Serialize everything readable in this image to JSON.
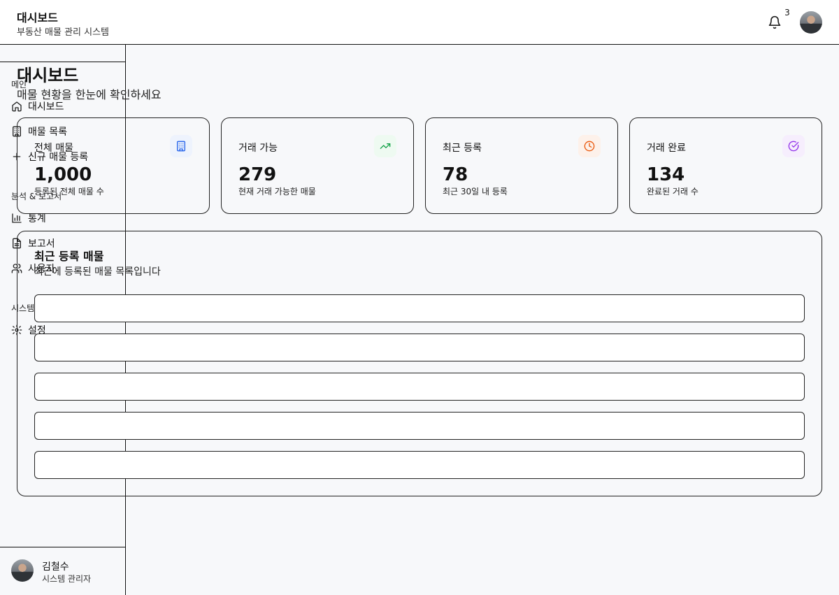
{
  "header": {
    "title": "대시보드",
    "subtitle": "부동산 매물 관리 시스템",
    "notification_count": "3"
  },
  "sidebar": {
    "sections": [
      {
        "label": "메인"
      },
      {
        "label": "분석 & 보고서"
      },
      {
        "label": "시스템"
      }
    ],
    "items": [
      {
        "label": "대시보드",
        "icon": "home-icon"
      },
      {
        "label": "매물 목록",
        "icon": "building-icon"
      },
      {
        "label": "신규 매물 등록",
        "icon": "plus-icon"
      },
      {
        "label": "통계",
        "icon": "bar-chart-icon"
      },
      {
        "label": "보고서",
        "icon": "file-text-icon"
      },
      {
        "label": "사용자",
        "icon": "users-icon"
      },
      {
        "label": "설정",
        "icon": "gear-icon"
      }
    ],
    "user": {
      "name": "김철수",
      "role": "시스템 관리자"
    }
  },
  "main": {
    "title": "대시보드",
    "subtitle": "매물 현황을 한눈에 확인하세요",
    "cards": [
      {
        "label": "전체 매물",
        "value": "1,000",
        "desc": "등록된 전체 매물 수",
        "icon": "building-icon",
        "color": "#2563eb",
        "bg": "#eef3fd"
      },
      {
        "label": "거래 가능",
        "value": "279",
        "desc": "현재 거래 가능한 매물",
        "icon": "trending-up-icon",
        "color": "#16a34a",
        "bg": "#eefaf1"
      },
      {
        "label": "최근 등록",
        "value": "78",
        "desc": "최근 30일 내 등록",
        "icon": "clock-icon",
        "color": "#ea580c",
        "bg": "#fdf1ea"
      },
      {
        "label": "거래 완료",
        "value": "134",
        "desc": "완료된 거래 수",
        "icon": "check-circle-icon",
        "color": "#9333ea",
        "bg": "#f6eefd"
      }
    ],
    "recent": {
      "title": "최근 등록 매물",
      "subtitle": "최근에 등록된 매물 목록입니다"
    }
  }
}
